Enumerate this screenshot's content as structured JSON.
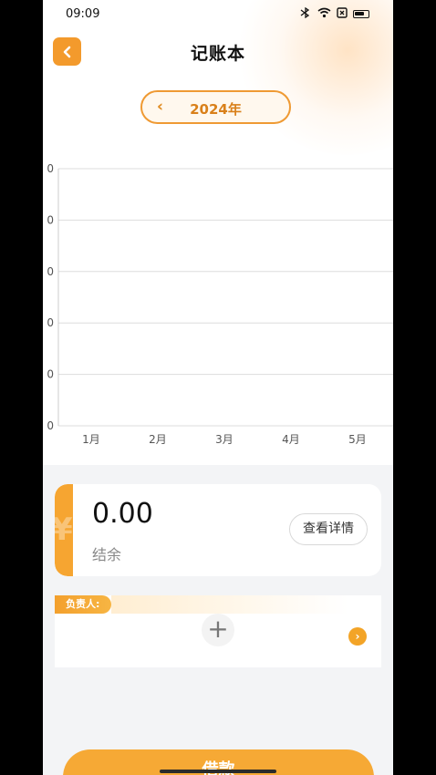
{
  "status_bar": {
    "time": "09:09",
    "icons": [
      "bluetooth-icon",
      "wifi-icon",
      "sim-icon",
      "battery-icon"
    ]
  },
  "header": {
    "title": "记账本",
    "back_icon": "chevron-left-icon"
  },
  "year_selector": {
    "prev_glyph": "‹",
    "year": "2024年"
  },
  "chart_data": {
    "type": "line",
    "categories": [
      "1月",
      "2月",
      "3月",
      "4月",
      "5月"
    ],
    "y_tick_labels": [
      "0",
      "0",
      "0",
      "0",
      "0",
      "0"
    ],
    "series": [],
    "grid": true
  },
  "summary": {
    "amount": "0.00",
    "label": "结余",
    "detail_button": "查看详情",
    "stripe_glyph": "¥"
  },
  "responsible": {
    "tag": "负责人:",
    "add_glyph": "+",
    "next_glyph": "›"
  },
  "bottom_action": {
    "label": "借款"
  },
  "colors": {
    "accent": "#f39a2c",
    "accent_text": "#d9801a",
    "background": "#f3f4f6"
  }
}
